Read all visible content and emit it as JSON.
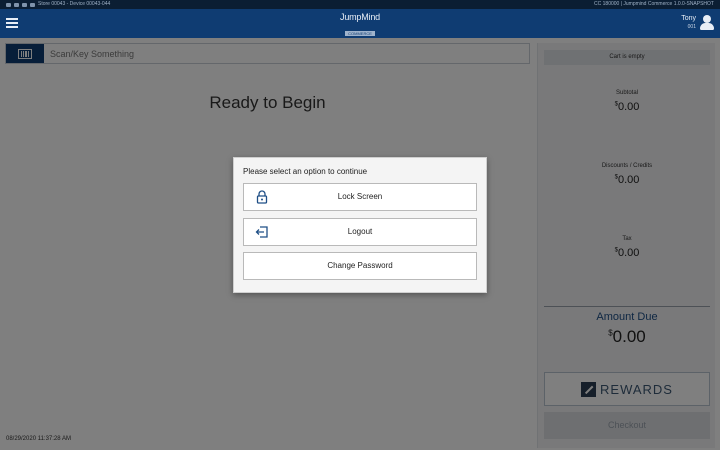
{
  "status_bar": {
    "left_text": "Store 00043 - Device 00043-044",
    "right_text": "CC 180000 | Jumpmind Commerce 1.0.0-SNAPSHOT"
  },
  "header": {
    "logo_main": "JumpMind",
    "logo_sub": "COMMERCE",
    "user_name": "Tony",
    "user_sub": "001",
    "menu_icon": "hamburger-menu-icon",
    "user_icon": "user-avatar-icon"
  },
  "scan": {
    "icon": "barcode-scanner-icon",
    "placeholder": "Scan/Key Something"
  },
  "main": {
    "ready_text": "Ready to Begin",
    "timestamp": "08/29/2020 11:37:28 AM"
  },
  "cart": {
    "empty_text": "Cart is empty",
    "currency_symbol": "$",
    "subtotal_label": "Subtotal",
    "subtotal_value": "0.00",
    "discounts_label": "Discounts / Credits",
    "discounts_value": "0.00",
    "tax_label": "Tax",
    "tax_value": "0.00",
    "amount_due_label": "Amount Due",
    "amount_due_value": "0.00",
    "rewards_label": "REWARDS",
    "rewards_icon": "rewards-arrow-icon",
    "checkout_label": "Checkout"
  },
  "dialog": {
    "title": "Please select an option to continue",
    "options": [
      {
        "label": "Lock Screen",
        "icon": "lock-icon"
      },
      {
        "label": "Logout",
        "icon": "logout-icon"
      },
      {
        "label": "Change Password",
        "icon": ""
      }
    ]
  },
  "colors": {
    "header_bg": "#0f3c72",
    "accent": "#1f4f86",
    "overlay": "rgba(0,0,0,0.5)",
    "icon_blue": "#1f4f86"
  }
}
